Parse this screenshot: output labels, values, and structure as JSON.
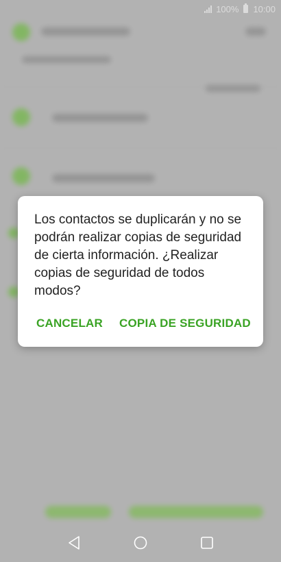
{
  "status_bar": {
    "battery_text": "100%",
    "time": "10:00"
  },
  "dialog": {
    "message": "Los contactos se duplicarán y no se podrán realizar copias de seguridad de cierta información. ¿Realizar copias de seguridad de todos modos?",
    "cancel_label": "CANCELAR",
    "confirm_label": "COPIA DE SEGURIDAD"
  },
  "colors": {
    "accent": "#3aa324",
    "scrim": "#c9c9c9",
    "dialog_bg": "#ffffff",
    "text": "#222222"
  },
  "icons": {
    "back": "back-triangle-icon",
    "home": "home-circle-icon",
    "recents": "recents-square-icon"
  }
}
